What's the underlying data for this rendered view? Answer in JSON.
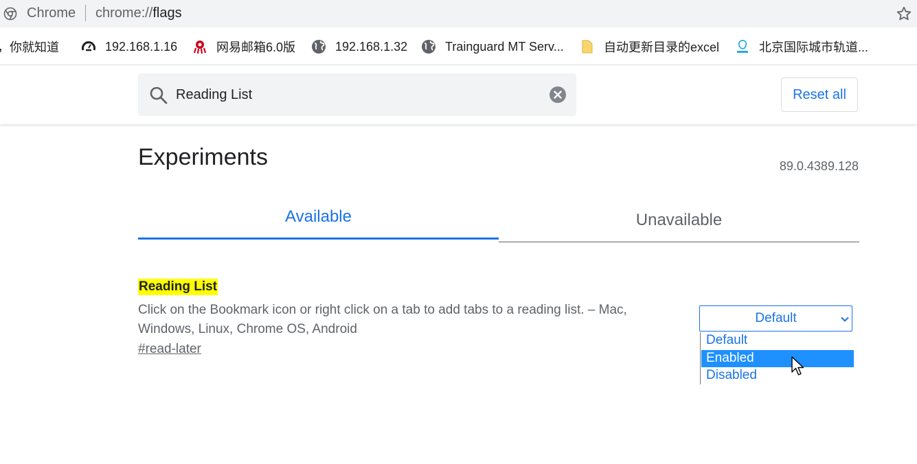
{
  "omnibox": {
    "site_name": "Chrome",
    "url_scheme": "chrome://",
    "url_path": "flags"
  },
  "bookmarks": [
    {
      "label": "，你就知道",
      "icon": "none"
    },
    {
      "label": "192.168.1.16",
      "icon": "gauge-icon"
    },
    {
      "label": "网易邮箱6.0版",
      "icon": "netease-mail-icon"
    },
    {
      "label": "192.168.1.32",
      "icon": "globe-icon"
    },
    {
      "label": "Trainguard MT Serv...",
      "icon": "globe-icon"
    },
    {
      "label": "自动更新目录的excel",
      "icon": "folder-icon"
    },
    {
      "label": "北京国际城市轨道...",
      "icon": "metro-icon"
    }
  ],
  "header": {
    "search_value": "Reading List",
    "reset_label": "Reset all"
  },
  "main": {
    "title": "Experiments",
    "version": "89.0.4389.128",
    "tabs": [
      {
        "label": "Available",
        "active": true
      },
      {
        "label": "Unavailable",
        "active": false
      }
    ]
  },
  "experiment": {
    "title": "Reading List",
    "description": "Click on the Bookmark icon or right click on a tab to add tabs to a reading list. – Mac, Windows, Linux, Chrome OS, Android",
    "link": "#read-later",
    "selected": "Default",
    "options": [
      "Default",
      "Enabled",
      "Disabled"
    ],
    "highlighted_option": "Enabled"
  },
  "colors": {
    "accent": "#1a73e8",
    "highlight": "#ffff00",
    "option_selected_bg": "#1e90ff"
  }
}
